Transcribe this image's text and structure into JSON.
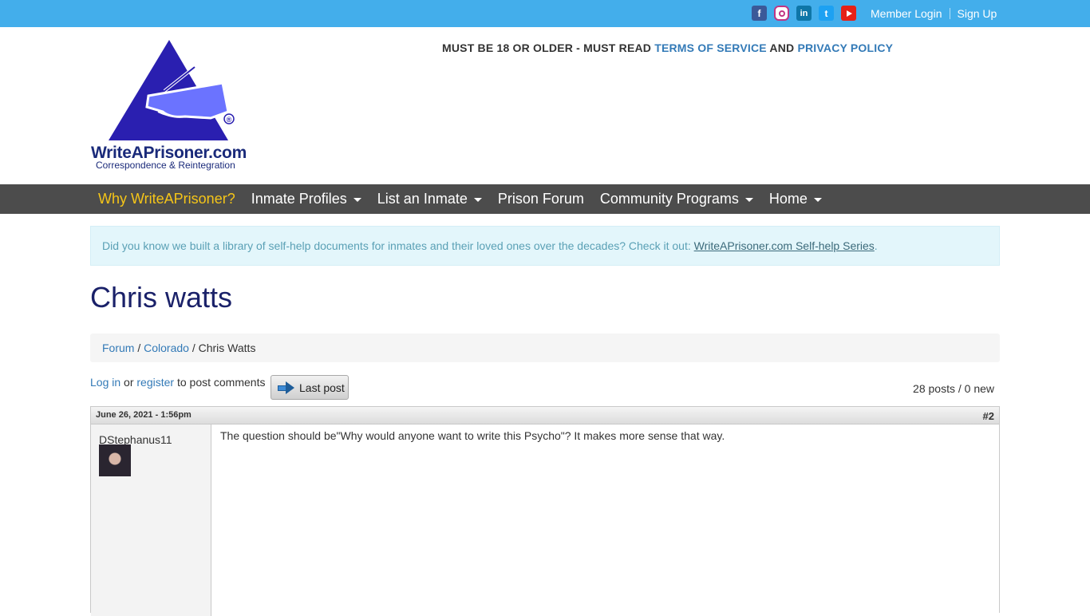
{
  "header": {
    "social": [
      "facebook-icon",
      "instagram-icon",
      "linkedin-icon",
      "twitter-icon",
      "youtube-icon"
    ],
    "member_login": "Member Login",
    "sign_up": "Sign Up"
  },
  "logo": {
    "name": "WriteAPrisoner.com",
    "tagline": "Correspondence & Reintegration",
    "registered": "®"
  },
  "notice": {
    "prefix": "MUST BE 18 OR OLDER - MUST READ",
    "terms": "TERMS OF SERVICE",
    "and": "AND",
    "privacy": "PRIVACY POLICY"
  },
  "nav": {
    "items": [
      {
        "label": "Why WriteAPrisoner?"
      },
      {
        "label": "Inmate Profiles"
      },
      {
        "label": "List an Inmate"
      },
      {
        "label": "Prison Forum"
      },
      {
        "label": "Community Programs"
      },
      {
        "label": "Home"
      }
    ]
  },
  "info": {
    "text": "Did you know we built a library of self-help documents for inmates and their loved ones over the decades? Check it out:",
    "link": "WriteAPrisoner.com Self-help Series",
    "period": "."
  },
  "page": {
    "title": "Chris watts"
  },
  "breadcrumb": {
    "forum": "Forum",
    "colorado": "Colorado",
    "current": "Chris Watts",
    "sep": "/"
  },
  "actions": {
    "login": "Log in",
    "or": "or",
    "register": "register",
    "suffix": "to post comments",
    "last_post": "Last post",
    "counts": "28 posts / 0 new"
  },
  "post": {
    "date": "June 26, 2021 - 1:56pm",
    "number": "#2",
    "author": "DStephanus11",
    "body": "The question should be\"Why would anyone want to write this Psycho\"? It makes more sense that way."
  },
  "colors": {
    "topbar": "#43aeeb",
    "navbar": "#4c4c4c",
    "nav_active": "#f5c518",
    "link": "#337ab7",
    "title": "#1a2169",
    "logo_blue": "#2a1fb0"
  }
}
